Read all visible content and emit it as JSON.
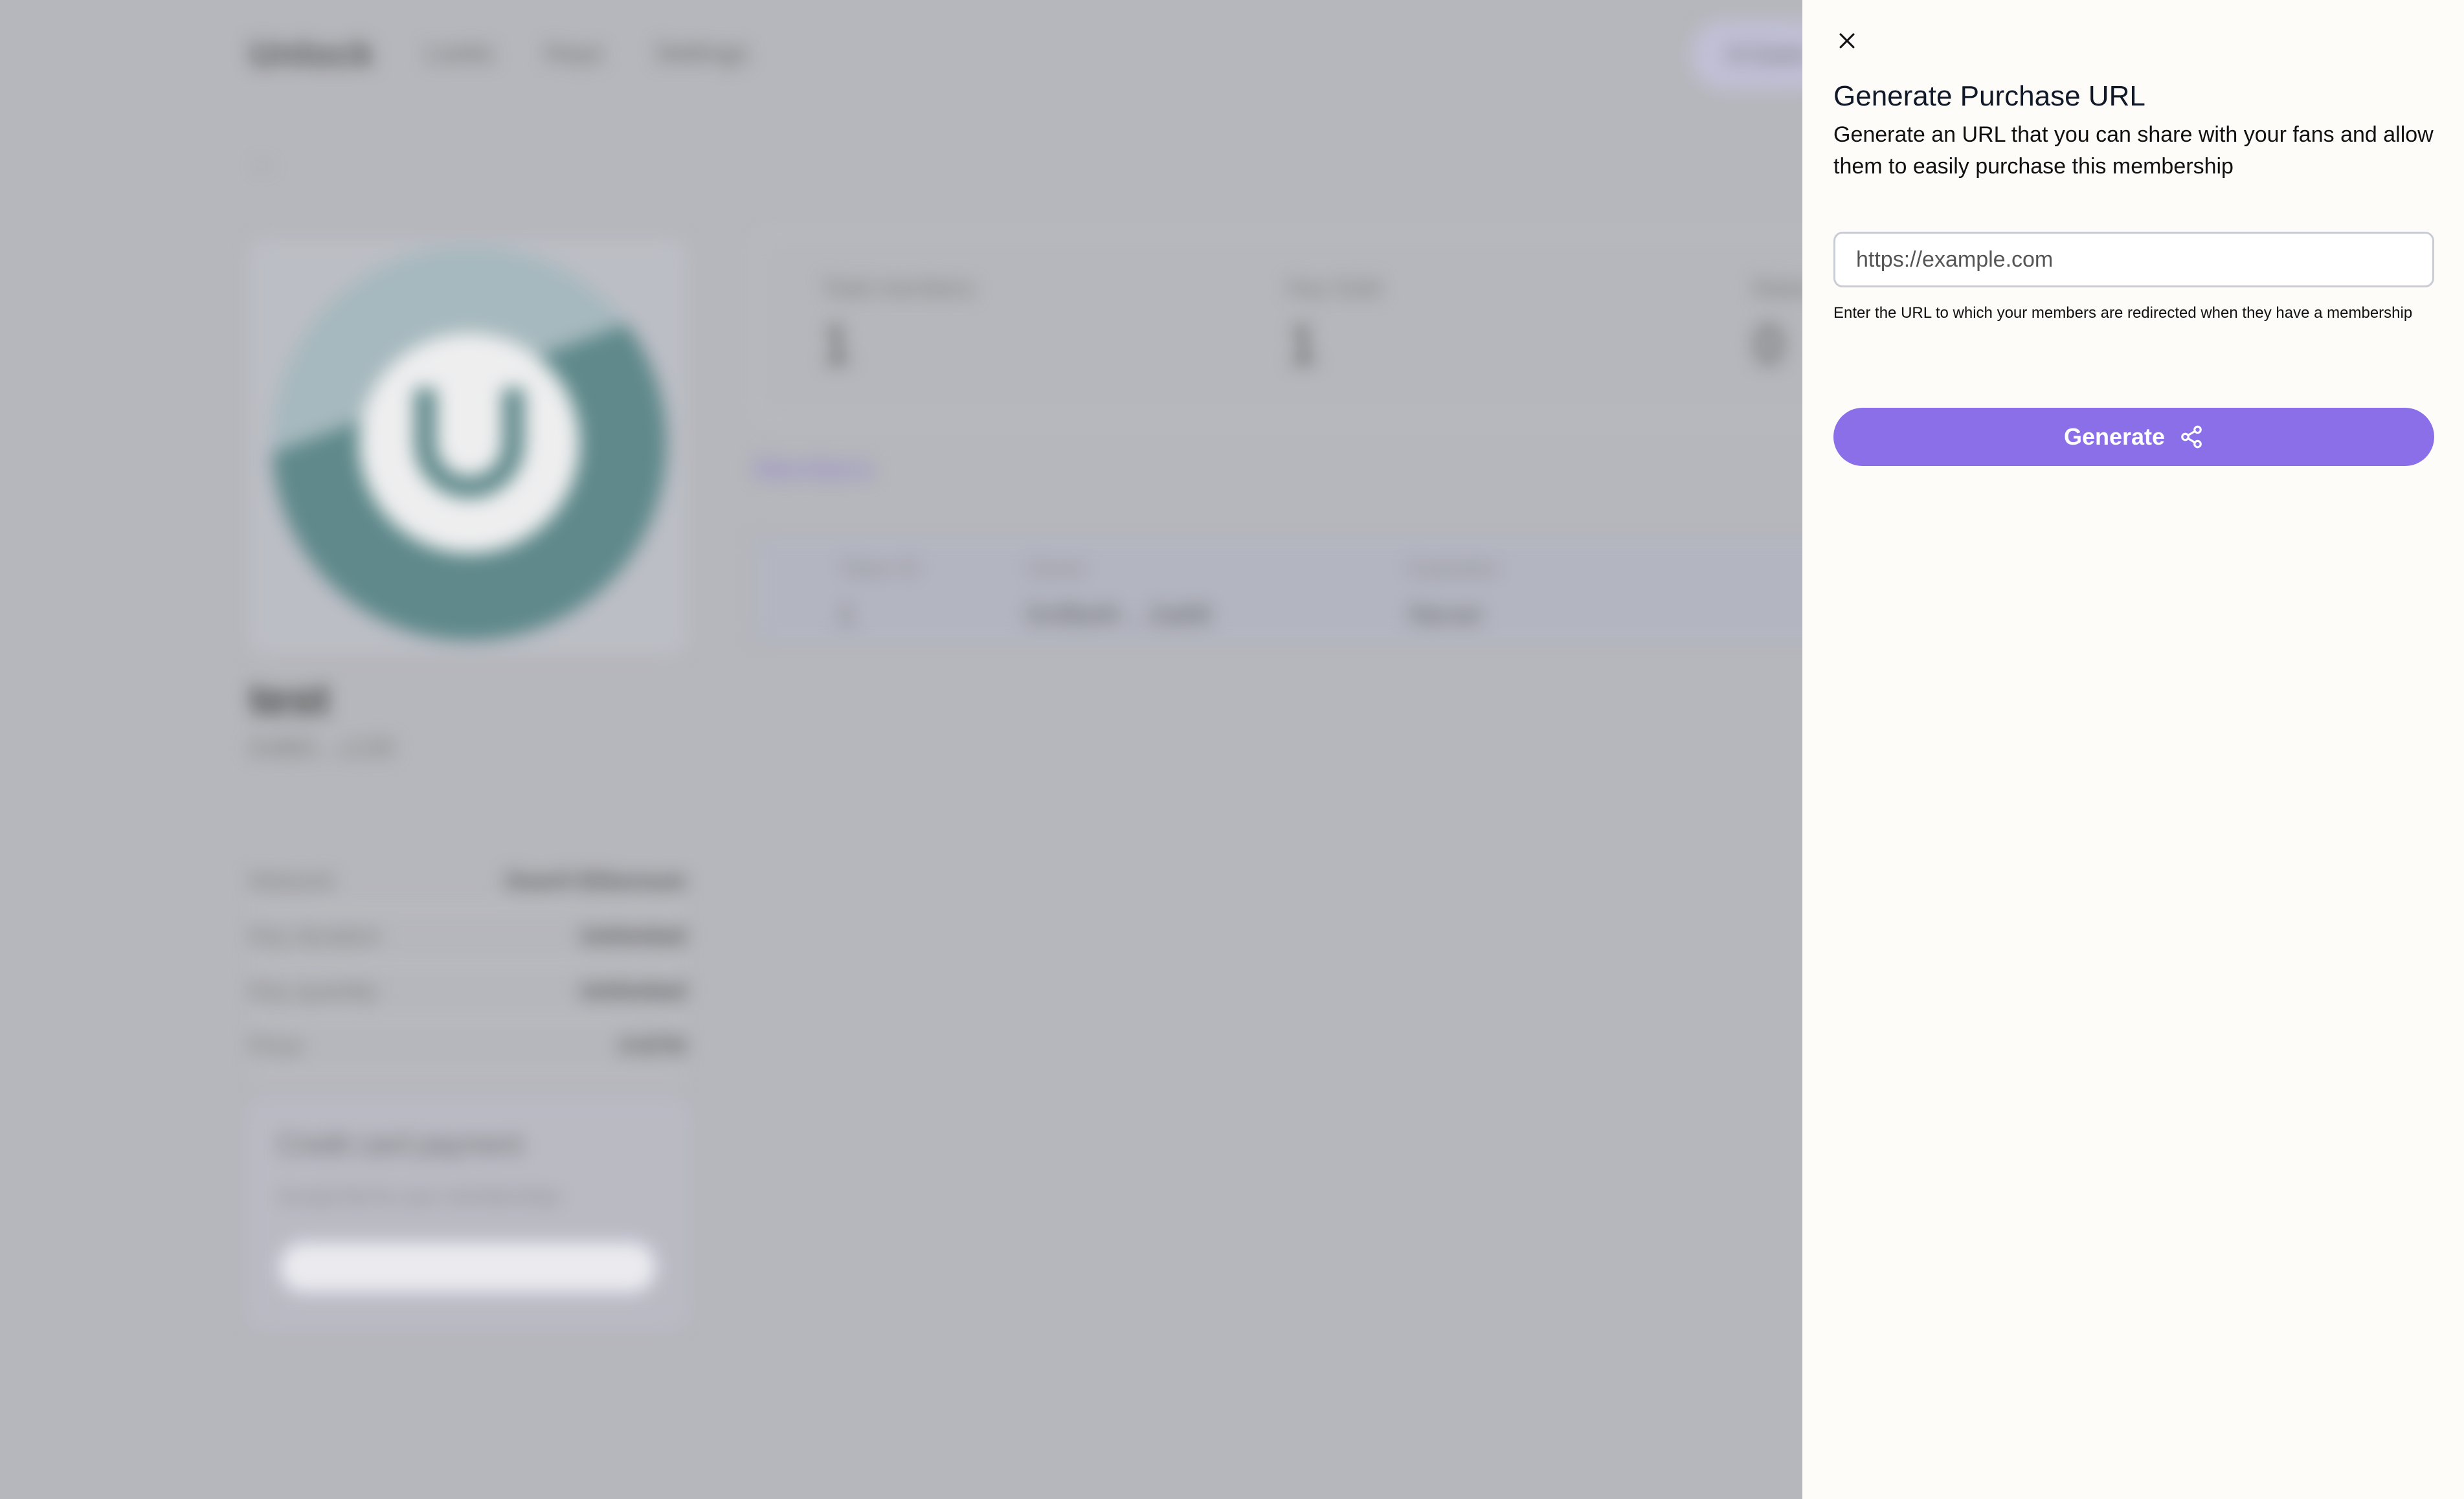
{
  "background": {
    "nav": {
      "logo": "Unlock",
      "links": [
        "Locks",
        "Keys",
        "Settings"
      ],
      "account_pill": "0 Conn"
    },
    "back": "←",
    "lock": {
      "name": "test",
      "address": "0x8b5…c130",
      "properties": [
        {
          "label": "Network",
          "value": "Goerli Ethereum"
        },
        {
          "label": "Key duration",
          "value": "Unlimited"
        },
        {
          "label": "Key quantity",
          "value": "Unlimited"
        },
        {
          "label": "Price",
          "value": "0 ETH"
        }
      ],
      "card": {
        "title": "Credit card payment",
        "text": "Accept fiat for your memberships"
      },
      "stats": [
        {
          "label": "Total members",
          "value": "1"
        },
        {
          "label": "Key Sold",
          "value": "1"
        },
        {
          "label": "Balance",
          "value": "0"
        }
      ],
      "tab": "Members",
      "table": {
        "headers": [
          "Token ID",
          "Owner",
          "Expiration"
        ],
        "row": [
          "1",
          "0x9bd4…2a68",
          "Never"
        ]
      }
    }
  },
  "drawer": {
    "title": "Generate Purchase URL",
    "description": "Generate an URL that you can share with your fans and allow them to easily purchase this membership",
    "url_input": {
      "placeholder": "https://example.com",
      "value": ""
    },
    "help_text": "Enter the URL to which your members are redirected when they have a membership",
    "generate_label": "Generate",
    "icons": {
      "close": "close-icon",
      "generate": "share-icon"
    }
  },
  "colors": {
    "accent": "#8b6fe8",
    "drawer_bg": "#fdfcf9",
    "overlay_bg": "#b9babe"
  }
}
